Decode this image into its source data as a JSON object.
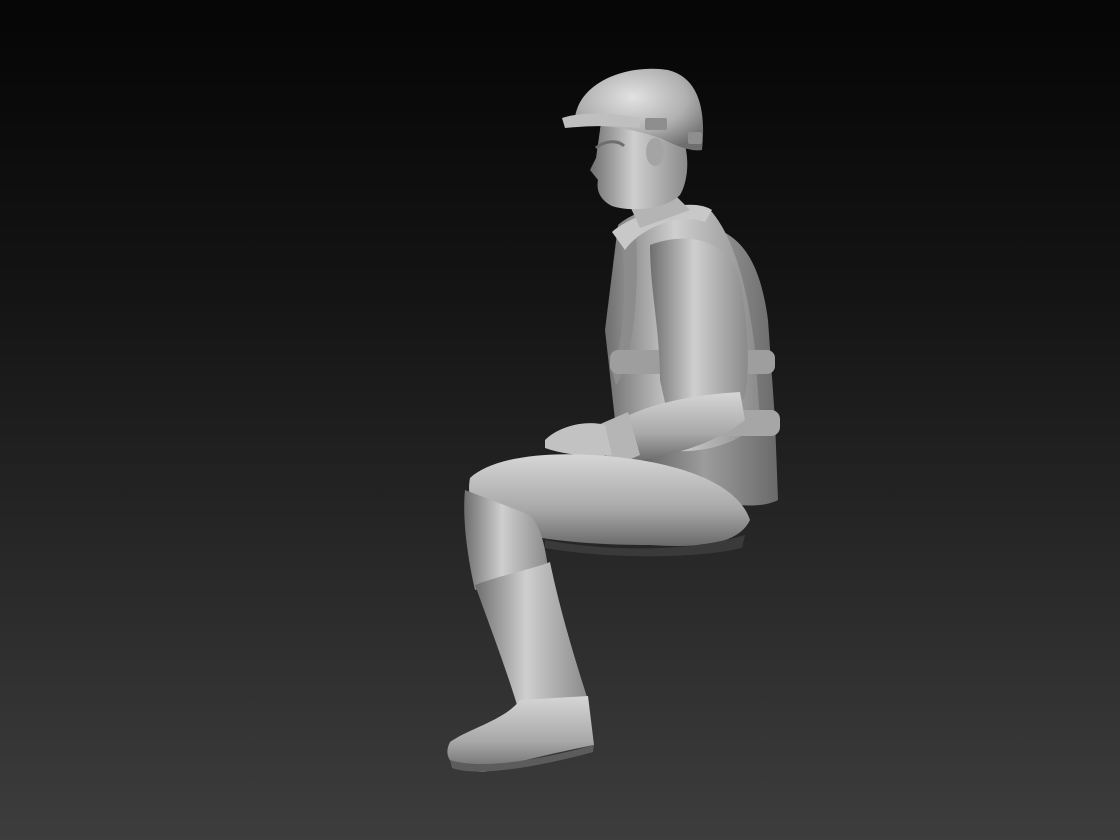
{
  "scene": {
    "subject": "seated-worker-figure",
    "colors": {
      "background_top": "#050505",
      "background_bottom": "#3d3d3d",
      "material_light": "#d0d0d0",
      "material_mid": "#9a9a9a",
      "material_dark": "#4a4a4a"
    }
  }
}
